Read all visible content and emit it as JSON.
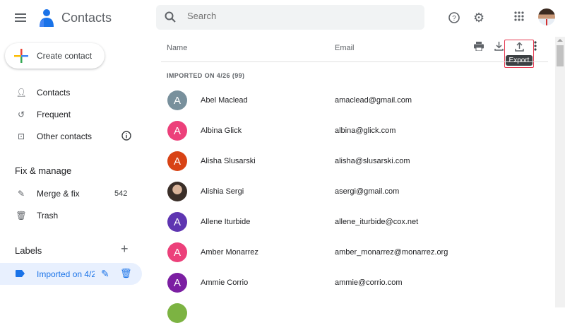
{
  "header": {
    "app_title": "Contacts",
    "search_placeholder": "Search"
  },
  "sidebar": {
    "create_label": "Create contact",
    "items": [
      {
        "label": "Contacts"
      },
      {
        "label": "Frequent"
      },
      {
        "label": "Other contacts"
      }
    ],
    "fix_heading": "Fix & manage",
    "merge_label": "Merge & fix",
    "merge_count": "542",
    "trash_label": "Trash",
    "labels_heading": "Labels",
    "label_item": "Imported on 4/2"
  },
  "list": {
    "col_name": "Name",
    "col_email": "Email",
    "group_heading": "IMPORTED ON 4/26 (99)",
    "tooltip": "Export",
    "contacts": [
      {
        "initial": "A",
        "name": "Abel Maclead",
        "email": "amaclead@gmail.com",
        "color": "#78909c"
      },
      {
        "initial": "A",
        "name": "Albina Glick",
        "email": "albina@glick.com",
        "color": "#ec407a"
      },
      {
        "initial": "A",
        "name": "Alisha Slusarski",
        "email": "alisha@slusarski.com",
        "color": "#d84315"
      },
      {
        "initial": "",
        "name": "Alishia Sergi",
        "email": "asergi@gmail.com",
        "color": "#5d4a3a"
      },
      {
        "initial": "A",
        "name": "Allene Iturbide",
        "email": "allene_iturbide@cox.net",
        "color": "#5e35b1"
      },
      {
        "initial": "A",
        "name": "Amber Monarrez",
        "email": "amber_monarrez@monarrez.org",
        "color": "#ec407a"
      },
      {
        "initial": "A",
        "name": "Ammie Corrio",
        "email": "ammie@corrio.com",
        "color": "#7b1fa2"
      }
    ]
  }
}
